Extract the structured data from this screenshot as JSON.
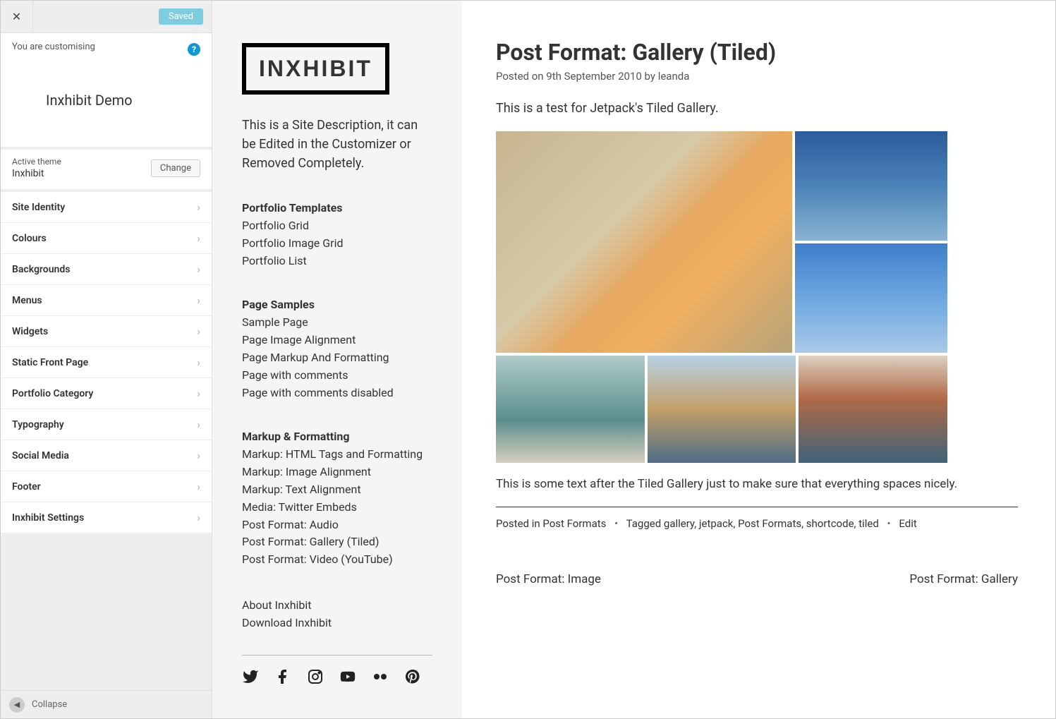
{
  "customizer": {
    "saved_label": "Saved",
    "customising_label": "You are customising",
    "site_name": "Inxhibit Demo",
    "active_theme_label": "Active theme",
    "active_theme": "Inxhibit",
    "change_label": "Change",
    "items": [
      "Site Identity",
      "Colours",
      "Backgrounds",
      "Menus",
      "Widgets",
      "Static Front Page",
      "Portfolio Category",
      "Typography",
      "Social Media",
      "Footer",
      "Inxhibit Settings"
    ],
    "collapse_label": "Collapse"
  },
  "sidebar": {
    "logo_text": "INXHIBIT",
    "description": "This is a Site Description, it can be Edited in the Customizer or Removed Completely.",
    "sections": [
      {
        "title": "Portfolio Templates",
        "links": [
          "Portfolio Grid",
          "Portfolio Image Grid",
          "Portfolio List"
        ]
      },
      {
        "title": "Page Samples",
        "links": [
          "Sample Page",
          "Page Image Alignment",
          "Page Markup And Formatting",
          "Page with comments",
          "Page with comments disabled"
        ]
      },
      {
        "title": "Markup & Formatting",
        "links": [
          "Markup: HTML Tags and Formatting",
          "Markup: Image Alignment",
          "Markup: Text Alignment",
          "Media: Twitter Embeds",
          "Post Format: Audio",
          "Post Format: Gallery (Tiled)",
          "Post Format: Video (YouTube)"
        ]
      }
    ],
    "footer_links": [
      "About Inxhibit",
      "Download Inxhibit"
    ],
    "social_icons": [
      "twitter",
      "facebook",
      "instagram",
      "youtube",
      "flickr",
      "pinterest"
    ]
  },
  "post": {
    "title": "Post Format: Gallery (Tiled)",
    "meta_prefix": "Posted on ",
    "date": "9th September 2010",
    "by_label": " by ",
    "author": "leanda",
    "lead": "This is a test for Jetpack's Tiled Gallery.",
    "after_text": "This is some text after the Tiled Gallery just to make sure that everything spaces nicely.",
    "posted_in_label": "Posted in ",
    "category": "Post Formats",
    "tagged_label": "Tagged ",
    "tags": "gallery, jetpack, Post Formats, shortcode, tiled",
    "edit_label": "Edit",
    "nav_prev": "Post Format: Image",
    "nav_next": "Post Format: Gallery"
  }
}
